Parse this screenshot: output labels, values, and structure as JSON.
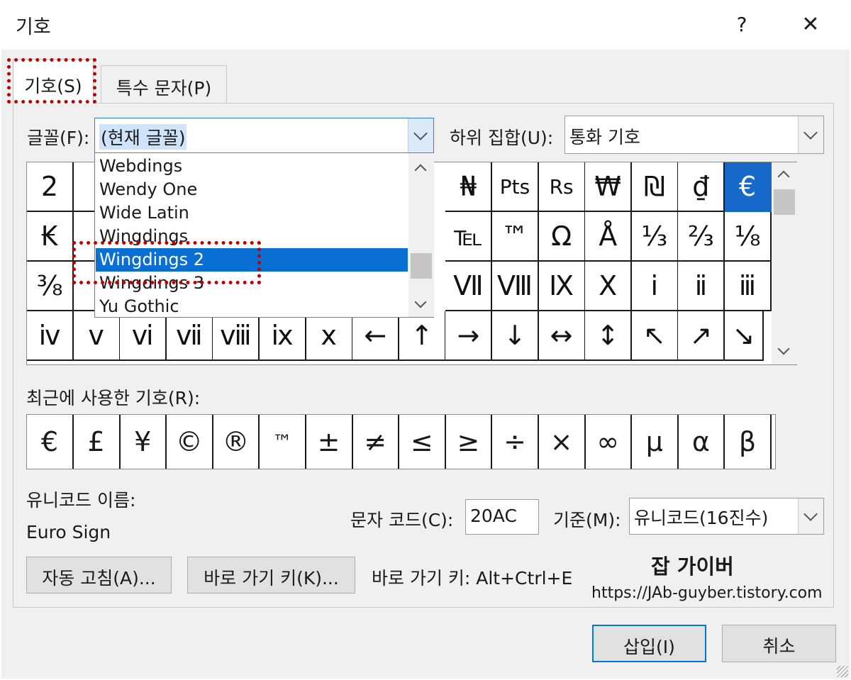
{
  "window": {
    "title": "기호",
    "help": "?",
    "close": "✕"
  },
  "tabs": [
    {
      "label": "기호(S)",
      "active": true
    },
    {
      "label": "특수 문자(P)",
      "active": false
    }
  ],
  "font": {
    "label": "글꼴(F):",
    "value": "(현재 글꼴)"
  },
  "subset": {
    "label": "하위 집합(U):",
    "value": "통화 기호"
  },
  "font_dropdown": {
    "items": [
      "Webdings",
      "Wendy One",
      "Wide Latin",
      "Wingdings",
      "Wingdings 2",
      "Wingdings 3",
      "Yu Gothic"
    ],
    "selected": "Wingdings 2"
  },
  "symbol_grid": {
    "rows": [
      [
        "2",
        "",
        "",
        "",
        "",
        "",
        "",
        "",
        "₦",
        "Pts",
        "Rs",
        "₩",
        "₪",
        "₫",
        "€"
      ],
      [
        "₭",
        "",
        "",
        "",
        "",
        "",
        "",
        "",
        "℡",
        "™",
        "Ω",
        "Å",
        "⅓",
        "⅔",
        "⅛"
      ],
      [
        "⅜",
        "",
        "",
        "",
        "",
        "",
        "",
        "",
        "Ⅶ",
        "Ⅷ",
        "Ⅸ",
        "Ⅹ",
        "ⅰ",
        "ⅱ",
        "ⅲ"
      ],
      [
        "ⅳ",
        "ⅴ",
        "ⅵ",
        "ⅶ",
        "ⅷ",
        "ⅸ",
        "ⅹ",
        "←",
        "↑",
        "→",
        "↓",
        "↔",
        "↕",
        "↖",
        "↗",
        "↘"
      ]
    ],
    "selected": "€"
  },
  "recent": {
    "label": "최근에 사용한 기호(R):",
    "symbols": [
      "€",
      "£",
      "¥",
      "©",
      "®",
      "™",
      "±",
      "≠",
      "≤",
      "≥",
      "÷",
      "×",
      "∞",
      "μ",
      "α",
      "β"
    ]
  },
  "unicode_name": {
    "label": "유니코드 이름:",
    "value": "Euro Sign"
  },
  "char_code": {
    "label": "문자 코드(C):",
    "value": "20AC"
  },
  "from": {
    "label": "기준(M):",
    "value": "유니코드(16진수)"
  },
  "buttons": {
    "autocorrect": "자동 고침(A)...",
    "shortcut_key": "바로 가기 키(K)...",
    "insert": "삽입(I)",
    "cancel": "취소"
  },
  "shortcut_text": "바로 가기 키: Alt+Ctrl+E",
  "watermark": {
    "title": "잡 가이버",
    "url": "https://JAb-guyber.tistory.com"
  },
  "colors": {
    "selection": "#1769c9",
    "dropdown_selection": "#0a6fd3",
    "annotation": "#c00000"
  }
}
